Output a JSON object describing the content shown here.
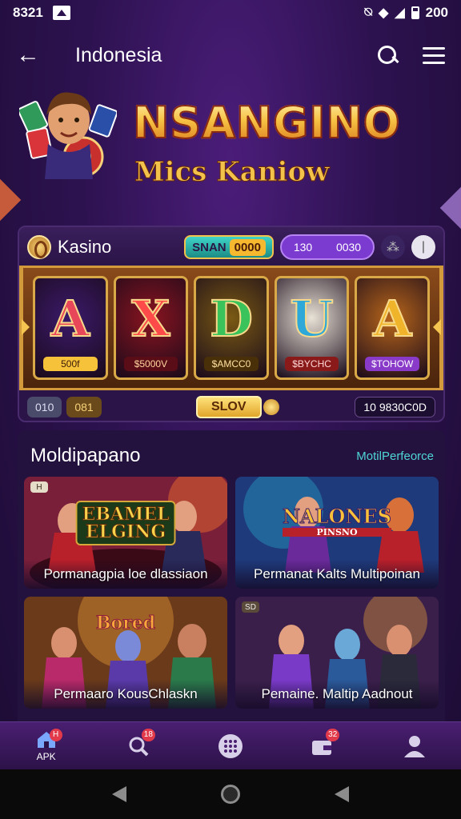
{
  "status_bar": {
    "time": "8321",
    "right_text": "200"
  },
  "app_bar": {
    "back_glyph": "←",
    "title": "Indonesia"
  },
  "hero": {
    "title": "NSANGINO",
    "subtitle": "Mics Kaniow"
  },
  "slot": {
    "casino_name": "Kasino",
    "pill_gold": {
      "label": "SNAN",
      "value": "0000"
    },
    "pill_purple": {
      "left": "130",
      "right": "0030"
    },
    "reels": [
      {
        "symbol": "A",
        "label": "500f",
        "color": "#e8475a",
        "bg": "#3b1a6b",
        "label_bg": "#f5c23a",
        "label_color": "#3a1a06"
      },
      {
        "symbol": "X",
        "label": "$5000V",
        "color": "#ff4a4a",
        "bg": "#8a1420",
        "label_bg": "#5a0d16",
        "label_color": "#ffd6a0"
      },
      {
        "symbol": "D",
        "label": "$AMCC0",
        "color": "#3ac35a",
        "bg": "#7a5a14",
        "label_bg": "#4a3008",
        "label_color": "#ffe0a0"
      },
      {
        "symbol": "U",
        "label": "$BYCHC",
        "color": "#2ea8d8",
        "bg": "#e8e2d6",
        "label_bg": "#8a1a1a",
        "label_color": "#ffd6d6"
      },
      {
        "symbol": "A",
        "label": "$TOHOW",
        "color": "#f0b42a",
        "bg": "#b8661a",
        "label_bg": "#8a3ac8",
        "label_color": "#ffffff"
      }
    ],
    "footer": {
      "left_a": "010",
      "left_b": "081",
      "spin_label": "SLOV",
      "balance": "10 9830C0D"
    }
  },
  "section": {
    "title": "Moldipapano",
    "link": "MotilPerfeorce",
    "cards": [
      {
        "badge": "H",
        "logo_line1": "EBAMEL",
        "logo_line2": "ELGING",
        "caption": "Pormanagpia loe dlassiaon"
      },
      {
        "badge": "",
        "logo_line1": "NALONES",
        "logo_line2": "PINSNO",
        "caption": "Permanat Kalts Multipoinan"
      },
      {
        "badge": "",
        "logo_line1": "Bored",
        "logo_line2": "",
        "caption": "Permaaro KousChlaskn"
      },
      {
        "badge": "SD",
        "logo_line1": "",
        "logo_line2": "",
        "caption": "Pemaine. Maltip Aadnout"
      }
    ]
  },
  "bottom_nav": {
    "items": [
      {
        "label": "APK",
        "badge": "H",
        "icon": "home-icon"
      },
      {
        "label": "",
        "badge": "18",
        "icon": "search-icon"
      },
      {
        "label": "",
        "badge": "",
        "icon": "grid-icon"
      },
      {
        "label": "",
        "badge": "32",
        "icon": "wallet-icon"
      },
      {
        "label": "",
        "badge": "",
        "icon": "profile-icon"
      }
    ]
  },
  "colors": {
    "accent": "#4fd6d6",
    "gold": "#f2c24a",
    "purple": "#7b3ad0",
    "badge": "#e23a4a"
  }
}
